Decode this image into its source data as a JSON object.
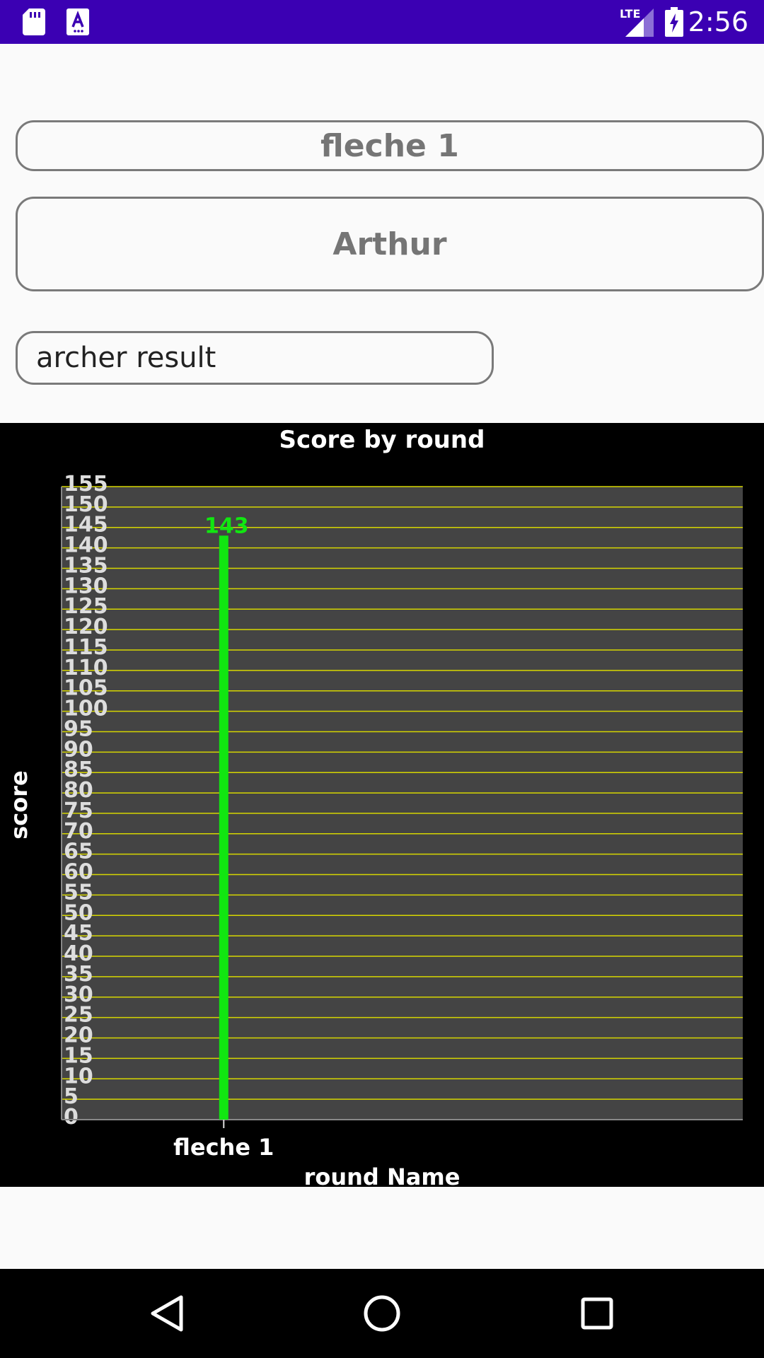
{
  "status_bar": {
    "time": "2:56",
    "network_label": "LTE",
    "icons": [
      "sd-card-icon",
      "keyboard-a-icon",
      "lte-signal-icon",
      "battery-charging-icon"
    ]
  },
  "round_button": {
    "label": "fleche 1"
  },
  "archer_button": {
    "label": "Arthur"
  },
  "result_field": {
    "value": "archer result"
  },
  "chart_data": {
    "type": "bar",
    "title": "Score by round",
    "xlabel": "round Name",
    "ylabel": "score",
    "categories": [
      "fleche 1"
    ],
    "values": [
      143
    ],
    "data_labels": [
      "143"
    ],
    "ylim": [
      0,
      155
    ],
    "ytick_step": 5,
    "grid": true,
    "colors": {
      "background": "#000000",
      "plot_background": "#444444",
      "grid": "#d6d600",
      "bar": "#11e611",
      "data_label": "#11e611",
      "tick_label": "#dddddd",
      "text": "#ffffff"
    }
  },
  "nav_bar": {
    "icons": [
      "back-triangle-icon",
      "home-circle-icon",
      "recents-square-icon"
    ]
  }
}
